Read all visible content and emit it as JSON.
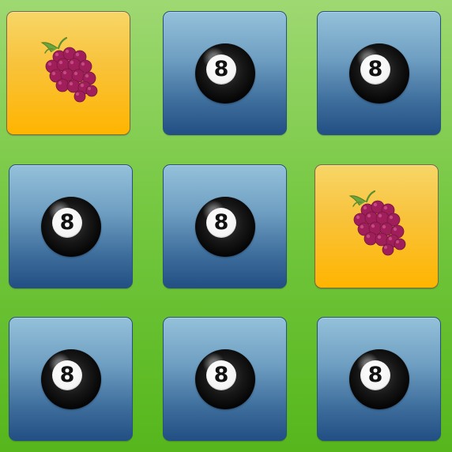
{
  "colors": {
    "background_top": "#9ed872",
    "background_bottom": "#56b61c",
    "card_back_top": "#94c1da",
    "card_back_bottom": "#224f84",
    "card_front_top": "#f7d667",
    "card_front_bottom": "#ffb500"
  },
  "board": {
    "rows": 3,
    "cols": 3,
    "cards": [
      {
        "state": "revealed",
        "icon": "grapes-icon"
      },
      {
        "state": "hidden",
        "icon": "eight-ball-icon",
        "label": "8"
      },
      {
        "state": "hidden",
        "icon": "eight-ball-icon",
        "label": "8"
      },
      {
        "state": "hidden",
        "icon": "eight-ball-icon",
        "label": "8"
      },
      {
        "state": "hidden",
        "icon": "eight-ball-icon",
        "label": "8"
      },
      {
        "state": "revealed",
        "icon": "grapes-icon"
      },
      {
        "state": "hidden",
        "icon": "eight-ball-icon",
        "label": "8"
      },
      {
        "state": "hidden",
        "icon": "eight-ball-icon",
        "label": "8"
      },
      {
        "state": "hidden",
        "icon": "eight-ball-icon",
        "label": "8"
      }
    ]
  }
}
